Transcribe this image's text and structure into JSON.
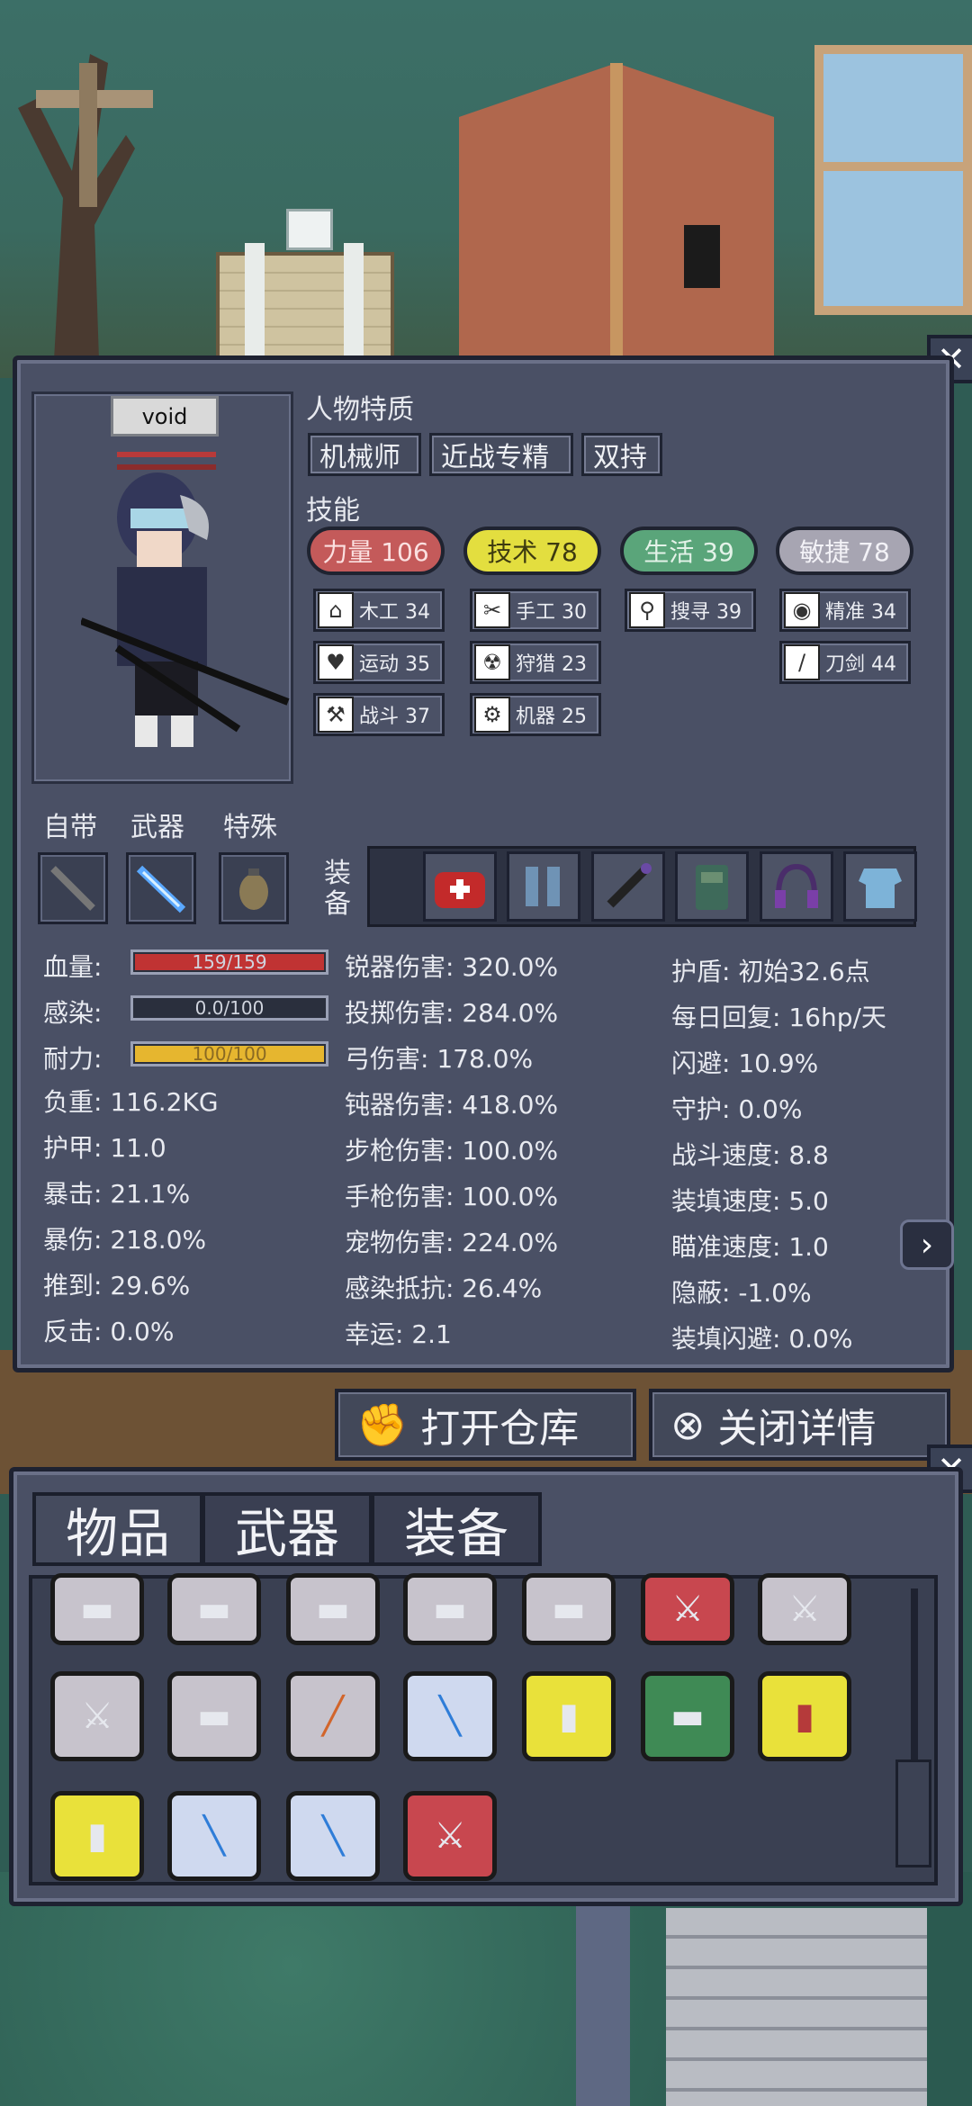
{
  "character": {
    "name": "void",
    "traits_title": "人物特质",
    "traits": [
      "机械师",
      "近战专精",
      "双持"
    ],
    "skills_title": "技能",
    "skill_categories": [
      {
        "label": "力量 106",
        "color": "#c45a5a"
      },
      {
        "label": "技术 78",
        "color": "#e3de3f"
      },
      {
        "label": "生活 39",
        "color": "#5aa57a"
      },
      {
        "label": "敏捷 78",
        "color": "#a7a5b2"
      }
    ],
    "subskills": [
      {
        "icon": "house-icon",
        "label": "木工 34"
      },
      {
        "icon": "scissors-icon",
        "label": "手工 30"
      },
      {
        "icon": "magnifier-icon",
        "label": "搜寻 39"
      },
      {
        "icon": "eye-icon",
        "label": "精准 34"
      },
      {
        "icon": "heart-icon",
        "label": "运动 35"
      },
      {
        "icon": "radiation-icon",
        "label": "狩猎 23"
      },
      {
        "icon": "sword-icon",
        "label": "刀剑 44"
      },
      {
        "icon": "axe-icon",
        "label": "战斗 37"
      },
      {
        "icon": "gear-icon",
        "label": "机器 25"
      }
    ]
  },
  "slots": {
    "labels": [
      "自带",
      "武器",
      "特殊"
    ],
    "equip_label": "装备"
  },
  "vitals": [
    {
      "label": "血量:",
      "text": "159/159",
      "fraction": 1.0,
      "color": "#c03333"
    },
    {
      "label": "感染:",
      "text": "0.0/100",
      "fraction": 0.0,
      "color": "#555b6c"
    },
    {
      "label": "耐力:",
      "text": "100/100",
      "fraction": 1.0,
      "color": "#e6b62f"
    }
  ],
  "stats_left": [
    "负重: 116.2KG",
    "护甲: 11.0",
    "暴击: 21.1%",
    "暴伤: 218.0%",
    "推到: 29.6%",
    "反击: 0.0%"
  ],
  "stats_mid": [
    "锐器伤害: 320.0%",
    "投掷伤害: 284.0%",
    "弓伤害: 178.0%",
    "钝器伤害: 418.0%",
    "步枪伤害: 100.0%",
    "手枪伤害: 100.0%",
    "宠物伤害: 224.0%",
    "感染抵抗: 26.4%",
    "幸运: 2.1"
  ],
  "stats_right": [
    "护盾: 初始32.6点",
    "每日回复: 16hp/天",
    "闪避: 10.9%",
    "守护: 0.0%",
    "战斗速度: 8.8",
    "装填速度: 5.0",
    "瞄准速度: 1.0",
    "隐蔽: -1.0%",
    "装填闪避: 0.0%"
  ],
  "buttons": {
    "open_storage": "打开仓库",
    "close_details": "关闭详情",
    "close": "✕"
  },
  "inventory": {
    "tabs": [
      "物品",
      "武器",
      "装备"
    ]
  }
}
